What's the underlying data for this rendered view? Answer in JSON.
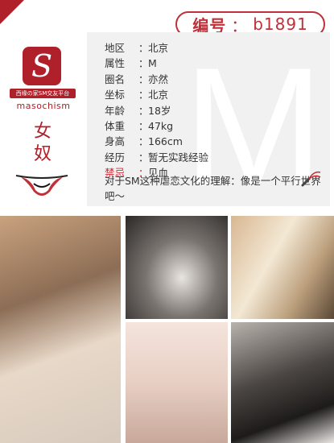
{
  "header": {
    "id_label": "编号",
    "id_colon": "：",
    "id_value": "b1891"
  },
  "brand": {
    "logo_letter": "S",
    "tagline": "西缘の家SM交友平台",
    "name": "masochism"
  },
  "role": {
    "line1": "女",
    "line2": "奴"
  },
  "watermark_letter": "M",
  "profile": {
    "fields": [
      {
        "key": "地区",
        "value": "北京"
      },
      {
        "key": "属性",
        "value": "M"
      },
      {
        "key": "圈名",
        "value": "亦然"
      },
      {
        "key": "坐标",
        "value": "北京"
      },
      {
        "key": "年龄",
        "value": "18岁"
      },
      {
        "key": "体重",
        "value": "47kg"
      },
      {
        "key": "身高",
        "value": "166cm"
      },
      {
        "key": "经历",
        "value": "暂无实践经验"
      },
      {
        "key": "禁忌",
        "value": "见血"
      }
    ],
    "description": "对于SM这种虐恋文化的理解：像是一个平行世界吧～"
  },
  "colors": {
    "accent": "#b0202a",
    "card_bg": "#f1f1f1"
  },
  "icons": [
    "bra-icon",
    "bottle-icon",
    "panty-icon",
    "whip-icon"
  ]
}
